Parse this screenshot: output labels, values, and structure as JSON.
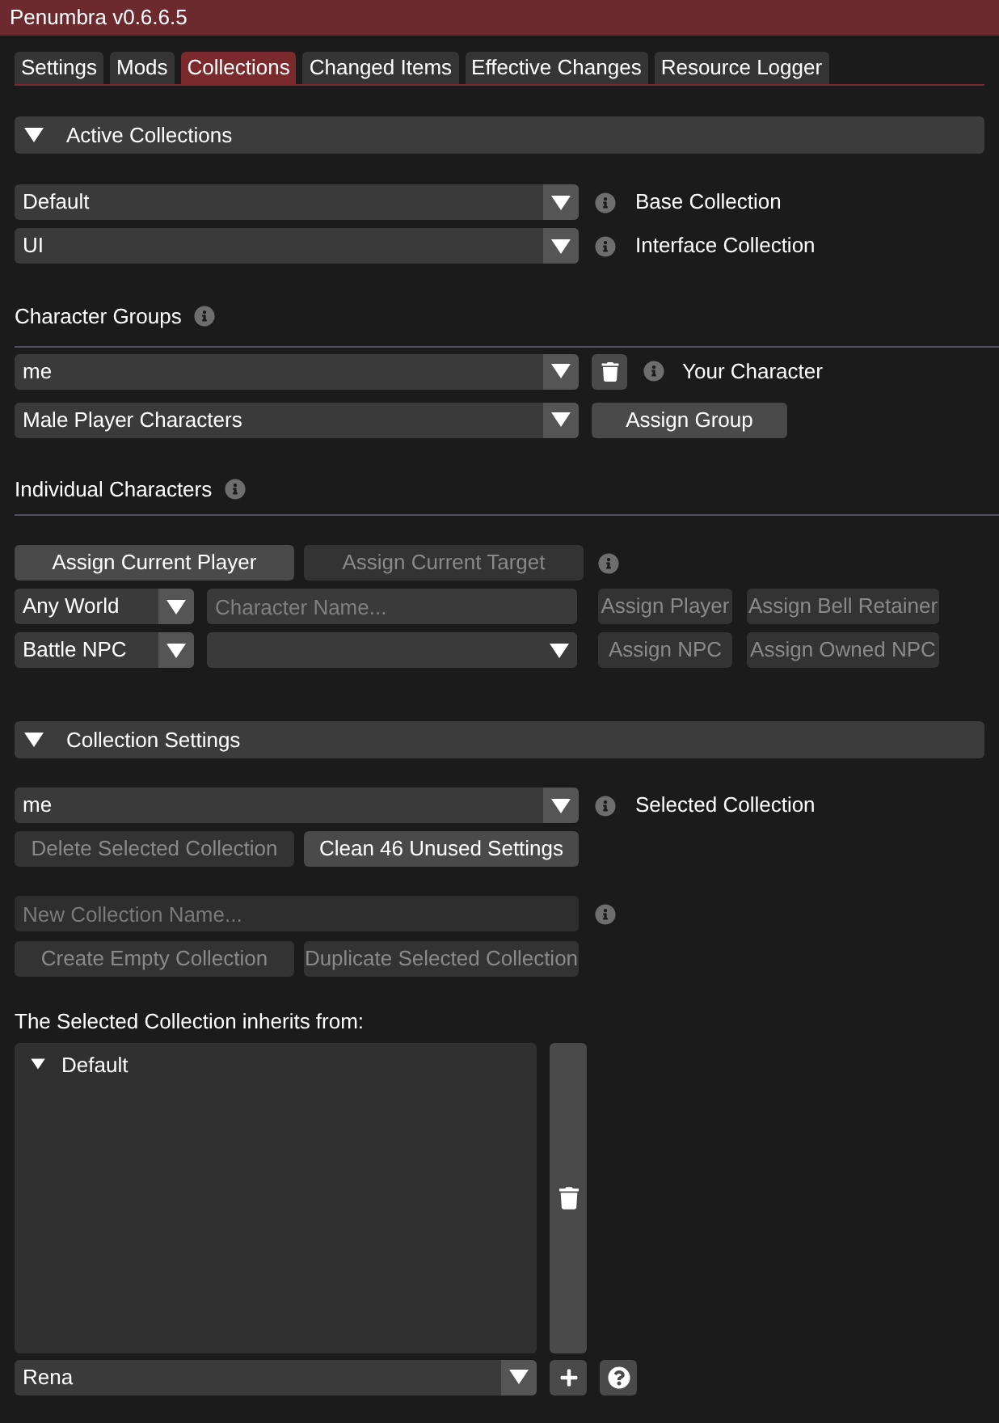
{
  "window": {
    "title": "Penumbra v0.6.6.5"
  },
  "tabs": [
    {
      "label": "Settings",
      "selected": false
    },
    {
      "label": "Mods",
      "selected": false
    },
    {
      "label": "Collections",
      "selected": true
    },
    {
      "label": "Changed Items",
      "selected": false
    },
    {
      "label": "Effective Changes",
      "selected": false
    },
    {
      "label": "Resource Logger",
      "selected": false
    }
  ],
  "active_collections": {
    "header": "Active Collections",
    "expanded": true,
    "assignments": [
      {
        "value": "Default",
        "label": "Base Collection"
      },
      {
        "value": "UI",
        "label": "Interface Collection"
      }
    ]
  },
  "character_groups": {
    "label": "Character Groups",
    "current": {
      "value": "me",
      "label": "Your Character"
    },
    "group": {
      "value": "Male Player Characters",
      "button": {
        "label": "Assign Group",
        "disabled": false
      }
    }
  },
  "individual_characters": {
    "label": "Individual Characters",
    "buttons": [
      {
        "label": "Assign Current Player",
        "disabled": false
      },
      {
        "label": "Assign Current Target",
        "disabled": true
      }
    ],
    "world": {
      "value": "Any World"
    },
    "name_field": {
      "placeholder": "Character Name..."
    },
    "player_buttons": [
      {
        "label": "Assign Player",
        "disabled": true
      },
      {
        "label": "Assign Bell Retainer",
        "disabled": true
      }
    ],
    "npc_type": {
      "value": "Battle NPC"
    },
    "npc_buttons": [
      {
        "label": "Assign NPC",
        "disabled": true
      },
      {
        "label": "Assign Owned NPC",
        "disabled": true
      }
    ]
  },
  "collection_settings": {
    "header": "Collection Settings",
    "expanded": true,
    "selected": {
      "value": "me",
      "label": "Selected Collection"
    },
    "buttons": [
      {
        "label": "Delete Selected Collection",
        "disabled": true
      },
      {
        "label": "Clean 46 Unused Settings",
        "disabled": false
      }
    ],
    "new_name": {
      "placeholder": "New Collection Name..."
    },
    "create_buttons": [
      {
        "label": "Create Empty Collection",
        "disabled": true
      },
      {
        "label": "Duplicate Selected Collection",
        "disabled": true
      }
    ],
    "inherit_label": "The Selected Collection inherits from:",
    "inherits": [
      {
        "label": "Default",
        "expanded": true
      }
    ],
    "add_combo": {
      "value": "Rena"
    }
  }
}
